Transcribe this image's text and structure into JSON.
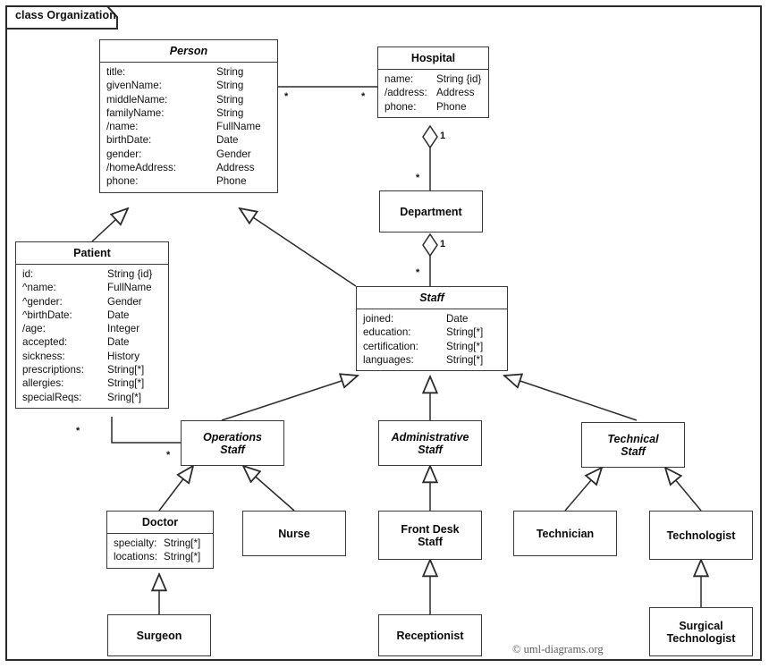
{
  "frame": {
    "label": "class Organization"
  },
  "credit": "© uml-diagrams.org",
  "classes": {
    "person": {
      "name": "Person",
      "attrs": [
        {
          "name": "title:",
          "type": "String"
        },
        {
          "name": "givenName:",
          "type": "String"
        },
        {
          "name": "middleName:",
          "type": "String"
        },
        {
          "name": "familyName:",
          "type": "String"
        },
        {
          "name": "/name:",
          "type": "FullName"
        },
        {
          "name": "birthDate:",
          "type": "Date"
        },
        {
          "name": "gender:",
          "type": "Gender"
        },
        {
          "name": "/homeAddress:",
          "type": "Address"
        },
        {
          "name": "phone:",
          "type": "Phone"
        }
      ]
    },
    "hospital": {
      "name": "Hospital",
      "attrs": [
        {
          "name": "name:",
          "type": "String {id}"
        },
        {
          "name": "/address:",
          "type": "Address"
        },
        {
          "name": "phone:",
          "type": "Phone"
        }
      ]
    },
    "department": {
      "name": "Department",
      "attrs": []
    },
    "patient": {
      "name": "Patient",
      "attrs": [
        {
          "name": "id:",
          "type": "String {id}"
        },
        {
          "name": "^name:",
          "type": "FullName"
        },
        {
          "name": "^gender:",
          "type": "Gender"
        },
        {
          "name": "^birthDate:",
          "type": "Date"
        },
        {
          "name": "/age:",
          "type": "Integer"
        },
        {
          "name": "accepted:",
          "type": "Date"
        },
        {
          "name": "sickness:",
          "type": "History"
        },
        {
          "name": "prescriptions:",
          "type": "String[*]"
        },
        {
          "name": "allergies:",
          "type": "String[*]"
        },
        {
          "name": "specialReqs:",
          "type": "Sring[*]"
        }
      ]
    },
    "staff": {
      "name": "Staff",
      "attrs": [
        {
          "name": "joined:",
          "type": "Date"
        },
        {
          "name": "education:",
          "type": "String[*]"
        },
        {
          "name": "certification:",
          "type": "String[*]"
        },
        {
          "name": "languages:",
          "type": "String[*]"
        }
      ]
    },
    "operations_staff": {
      "name": "Operations\nStaff",
      "attrs": []
    },
    "administrative_staff": {
      "name": "Administrative\nStaff",
      "attrs": []
    },
    "technical_staff": {
      "name": "Technical\nStaff",
      "attrs": []
    },
    "doctor": {
      "name": "Doctor",
      "attrs": [
        {
          "name": "specialty:",
          "type": "String[*]"
        },
        {
          "name": "locations:",
          "type": "String[*]"
        }
      ]
    },
    "nurse": {
      "name": "Nurse",
      "attrs": []
    },
    "front_desk_staff": {
      "name": "Front Desk\nStaff",
      "attrs": []
    },
    "technician": {
      "name": "Technician",
      "attrs": []
    },
    "technologist": {
      "name": "Technologist",
      "attrs": []
    },
    "surgeon": {
      "name": "Surgeon",
      "attrs": []
    },
    "receptionist": {
      "name": "Receptionist",
      "attrs": []
    },
    "surgical_technologist": {
      "name": "Surgical\nTechnologist",
      "attrs": []
    }
  },
  "multiplicities": {
    "person_hospital_src": "*",
    "person_hospital_tgt": "*",
    "hospital_department_one": "1",
    "hospital_department_many": "*",
    "department_staff_one": "1",
    "department_staff_many": "*",
    "patient_ops_src": "*",
    "patient_ops_tgt": "*"
  },
  "colors": {
    "line": "#3a3a3a",
    "text": "#111111",
    "background": "#ffffff"
  }
}
